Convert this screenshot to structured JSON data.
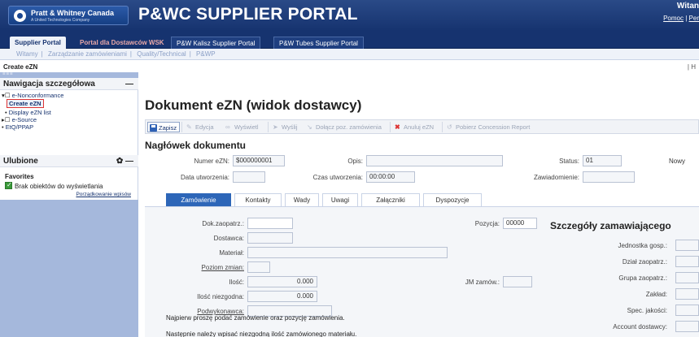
{
  "header": {
    "logo_name": "Pratt & Whitney Canada",
    "logo_sub": "A United Technologies Company",
    "portal_title": "P&WC SUPPLIER PORTAL",
    "welcome": "Witan",
    "help": "Pomoc",
    "help_sep": "|",
    "help_cut": "Per"
  },
  "tabs": [
    {
      "label": "Supplier Portal"
    },
    {
      "label": "Portal dla Dostawców WSK"
    },
    {
      "label": "P&W Kalisz Supplier Portal"
    },
    {
      "label": "P&W Tubes Supplier Portal"
    }
  ],
  "subnav": [
    "Witamy",
    "Zarządzanie zamówieniami",
    "Quality/Technical",
    "P&WP"
  ],
  "page_title": "Create eZN",
  "page_title_right": "| H",
  "sidebar": {
    "nav_title": "Nawigacja szczegółowa",
    "nav_ctl": "—",
    "tree": {
      "eNonconformance": "e-Nonconformance",
      "create": "Create eZN",
      "display": "Display eZN list",
      "esource": "e-Source",
      "etq": "EtQ/PPAP"
    },
    "fav_panel_title": "Ulubione",
    "fav_title": "Favorites",
    "fav_empty": "Brak obiektów do wyświetlania",
    "fav_sort": "Porządkowanie wpisów"
  },
  "main": {
    "doc_title": "Dokument eZN (widok dostawcy)",
    "toolbar": {
      "save": "Zapisz",
      "edit": "Edycja",
      "show": "Wyświetl",
      "send": "Wyślij",
      "attach": "Dołącz poz. zamówienia",
      "cancel": "Anuluj eZN",
      "concession": "Pobierz Concession Report"
    },
    "section_title": "Nagłówek dokumentu",
    "fields": {
      "numer_label": "Numer eZN:",
      "numer_value": "$000000001",
      "opis_label": "Opis:",
      "opis_value": "",
      "status_label": "Status:",
      "status_value": "01",
      "status_text": "Nowy",
      "data_label": "Data utworzenia:",
      "data_value": "",
      "czas_label": "Czas utworzenia:",
      "czas_value": "00:00:00",
      "zaw_label": "Zawiadomienie:",
      "zaw_value": ""
    },
    "inner_tabs": [
      "Zamówienie",
      "Kontakty",
      "Wady",
      "Uwagi",
      "Załączniki",
      "Dyspozycje"
    ],
    "order": {
      "dok_label": "Dok.zaopatrz.:",
      "dostawca_label": "Dostawca:",
      "material_label": "Materiał:",
      "poziom_label": "Poziom zmian:",
      "ilosc_label": "Ilość:",
      "ilosc_value": "0.000",
      "ilosc_nz_label": "Ilość niezgodna:",
      "ilosc_nz_value": "0.000",
      "podwyk_label": "Podwykonawca:",
      "pozycja_label": "Pozycja:",
      "pozycja_value": "00000",
      "jm_label": "JM zamów.:",
      "info1": "Najpierw proszę podać zamówienie oraz pozycję zamówienia.",
      "info2": "Następnie należy wpisać niezgodną ilość zamówionego materiału."
    },
    "details": {
      "title": "Szczegóły zamawiającego",
      "jednostka": "Jednostka gosp.:",
      "dzial": "Dział zaopatrz.:",
      "grupa": "Grupa zaopatrz.:",
      "zaklad": "Zakład:",
      "spec": "Spec. jakości:",
      "account": "Account dostawcy:"
    }
  }
}
